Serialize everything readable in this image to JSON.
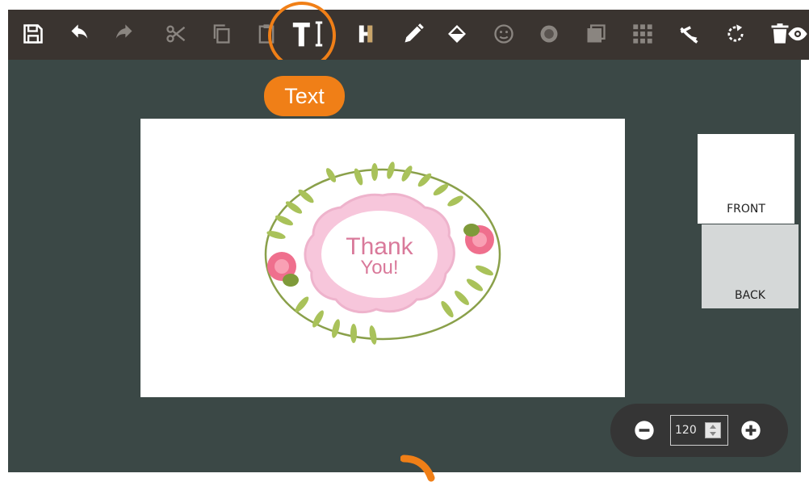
{
  "toolbar": {
    "tools": [
      {
        "icon": "save-icon",
        "active": true
      },
      {
        "icon": "undo-icon",
        "active": true
      },
      {
        "icon": "redo-icon",
        "active": false
      },
      {
        "icon": "cut-icon",
        "active": false
      },
      {
        "icon": "copy-icon",
        "active": false
      },
      {
        "icon": "paste-icon",
        "active": false
      },
      {
        "icon": "text-icon",
        "active": true
      },
      {
        "icon": "letter-h-icon",
        "active": true
      },
      {
        "icon": "pencil-icon",
        "active": true
      },
      {
        "icon": "fill-icon",
        "active": true
      },
      {
        "icon": "face-icon",
        "active": false
      },
      {
        "icon": "badge-icon",
        "active": false
      },
      {
        "icon": "layer-icon",
        "active": false
      },
      {
        "icon": "grid-icon",
        "active": false
      },
      {
        "icon": "crop-icon",
        "active": true
      },
      {
        "icon": "rotate-icon",
        "active": true
      },
      {
        "icon": "trash-icon",
        "active": true
      },
      {
        "icon": "eye-icon",
        "active": true
      }
    ]
  },
  "tooltip": {
    "label": "Text"
  },
  "card": {
    "line1": "Thank",
    "line2": "You!"
  },
  "sides": {
    "front_label": "FRONT",
    "back_label": "BACK"
  },
  "zoom": {
    "value": "120"
  },
  "colors": {
    "toolbar_bg": "#3a3430",
    "canvas_bg": "#3b4846",
    "accent": "#f07f17",
    "zoom_bg": "#353535"
  }
}
